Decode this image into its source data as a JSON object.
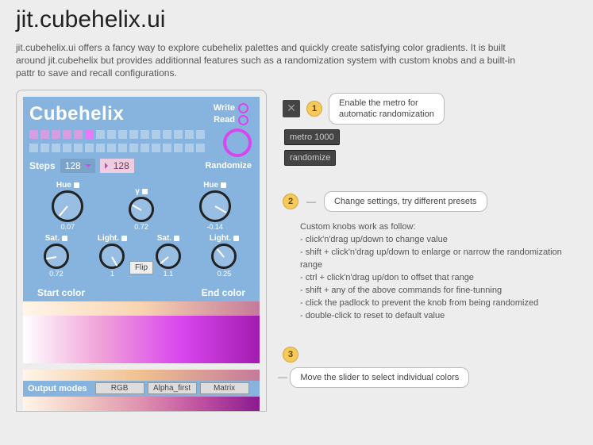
{
  "page_title": "jit.cubehelix.ui",
  "page_desc": "jit.cubehelix.ui offers a fancy way to explore cubehelix palettes and quickly create satisfying color gradients. It is built around jit.cubehelix but provides additionnal features such as a randomization system with custom knobs and a built-in pattr to save and recall configurations.",
  "panel": {
    "title": "Cubehelix",
    "write": "Write",
    "read": "Read",
    "steps_label": "Steps",
    "steps_value": "128",
    "steps_output": "128",
    "randomize_label": "Randomize",
    "start": {
      "hue": {
        "label": "Hue",
        "value": "0.07"
      },
      "sat": {
        "label": "Sat.",
        "value": "0.72"
      },
      "light": {
        "label": "Light.",
        "value": "1"
      }
    },
    "gamma": {
      "label": "γ",
      "value": "0.72"
    },
    "end": {
      "hue": {
        "label": "Hue",
        "value": "-0.14"
      },
      "sat": {
        "label": "Sat.",
        "value": "1.1"
      },
      "light": {
        "label": "Light.",
        "value": "0.25"
      }
    },
    "flip": "Flip",
    "start_label": "Start color",
    "end_label": "End color",
    "output_modes": "Output modes",
    "mode_rgb": "RGB",
    "mode_alpha": "Alpha_first",
    "mode_matrix": "Matrix"
  },
  "step1": {
    "num": "1",
    "tooltip": "Enable the metro for\nautomatic randomization",
    "metro": "metro 1000",
    "randomize": "randomize"
  },
  "step2": {
    "num": "2",
    "tooltip": "Change settings, try different presets",
    "help_title": "Custom knobs work as follow:",
    "help_lines": [
      "- click'n'drag up/down to change value",
      "- shift + click'n'drag up/down to enlarge or narrow the randomization range",
      "- ctrl + click'n'drag up/don to offset that range",
      "- shift + any of the above commands for fine-tunning",
      "- click the padlock to prevent the knob from being randomized",
      "- double-click to reset to default value"
    ]
  },
  "step3": {
    "num": "3",
    "tooltip": "Move the slider to select individual colors"
  }
}
